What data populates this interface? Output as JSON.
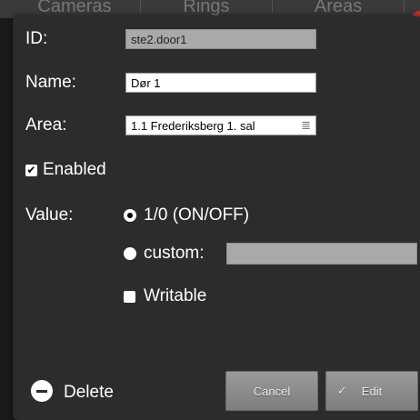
{
  "background_tabs": [
    "Cameras",
    "Rings",
    "Areas"
  ],
  "form": {
    "id_label": "ID:",
    "id_value": "ste2.door1",
    "name_label": "Name:",
    "name_value": "Dør 1",
    "area_label": "Area:",
    "area_value": "1.1 Frederiksberg 1. sal",
    "enabled_label": "Enabled",
    "enabled_checked": true,
    "value_label": "Value:",
    "option_binary": "1/0 (ON/OFF)",
    "option_custom": "custom:",
    "custom_value": "",
    "writable_label": "Writable",
    "writable_checked": false
  },
  "actions": {
    "delete_label": "Delete",
    "cancel_label": "Cancel",
    "edit_label": "Edit"
  },
  "icons": {
    "checkmark": "✔",
    "menu": "≣",
    "edit_check": "✓"
  },
  "colors": {
    "dialog_bg": "#2c2c2c",
    "button_gray": "#8a8a8a",
    "disabled_field": "#a9a9a9"
  }
}
